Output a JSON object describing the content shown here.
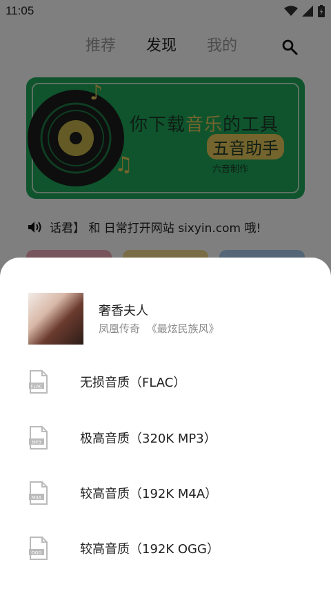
{
  "status": {
    "time": "11:05"
  },
  "tabs": [
    "推荐",
    "发现",
    "我的"
  ],
  "banner": {
    "line1_a": "你下载",
    "line1_b": "音乐",
    "line1_c": "的工具",
    "line2": "五音助手",
    "line3": "六音制作"
  },
  "notice": {
    "text": "话君】 和 日常打开网站 sixyin.com 哦!"
  },
  "sheet": {
    "song_title": "奢香夫人",
    "artist": "凤凰传奇",
    "album": "《最炫民族风》",
    "options": [
      {
        "label": "无损音质（FLAC）",
        "format": "FLAC"
      },
      {
        "label": "极高音质（320K MP3）",
        "format": "MP3"
      },
      {
        "label": "较高音质（192K M4A）",
        "format": "M4A"
      },
      {
        "label": "较高音质（192K OGG）",
        "format": "OGG"
      }
    ]
  },
  "colors": {
    "banner_green": "#1ea85a",
    "accent_gold": "#e8c85a"
  }
}
